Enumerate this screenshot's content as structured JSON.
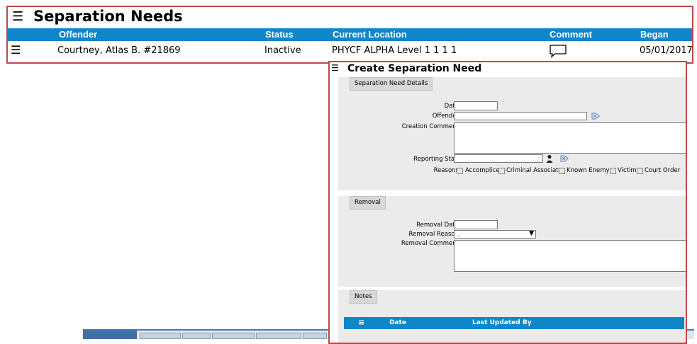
{
  "separation_needs": {
    "title": "Separation Needs",
    "columns": {
      "offender": "Offender",
      "status": "Status",
      "current_location": "Current Location",
      "comment": "Comment",
      "began": "Began"
    },
    "rows": [
      {
        "offender": "Courtney, Atlas B. #21869",
        "status": "Inactive",
        "current_location": "PHYCF ALPHA Level 1 1 1 1",
        "comment_icon": "speech-bubble-icon",
        "began": "05/01/2017"
      }
    ]
  },
  "dialog": {
    "title": "Create Separation Need",
    "details": {
      "tab_label": "Separation Need Details",
      "date_label": "Date",
      "date_value": "",
      "offender_label": "Offender",
      "offender_value": "",
      "creation_comment_label": "Creation Comment",
      "creation_comment_value": "",
      "reporting_staff_label": "Reporting Staff",
      "reporting_staff_value": "",
      "reasons_label": "Reasons",
      "reasons": [
        "Accomplice",
        "Criminal Associate",
        "Known Enemy",
        "Victim",
        "Court Order"
      ]
    },
    "removal": {
      "tab_label": "Removal",
      "removal_date_label": "Removal Date",
      "removal_date_value": "",
      "removal_reason_label": "Removal Reason",
      "removal_reason_value": "..",
      "removal_comment_label": "Removal Comment",
      "removal_comment_value": ""
    },
    "notes": {
      "tab_label": "Notes",
      "columns": {
        "date": "Date",
        "last_updated_by": "Last Updated By"
      }
    }
  },
  "colors": {
    "header_blue": "#0e86c9",
    "highlight_border": "#b94a4a",
    "section_gray": "#ebebeb"
  }
}
